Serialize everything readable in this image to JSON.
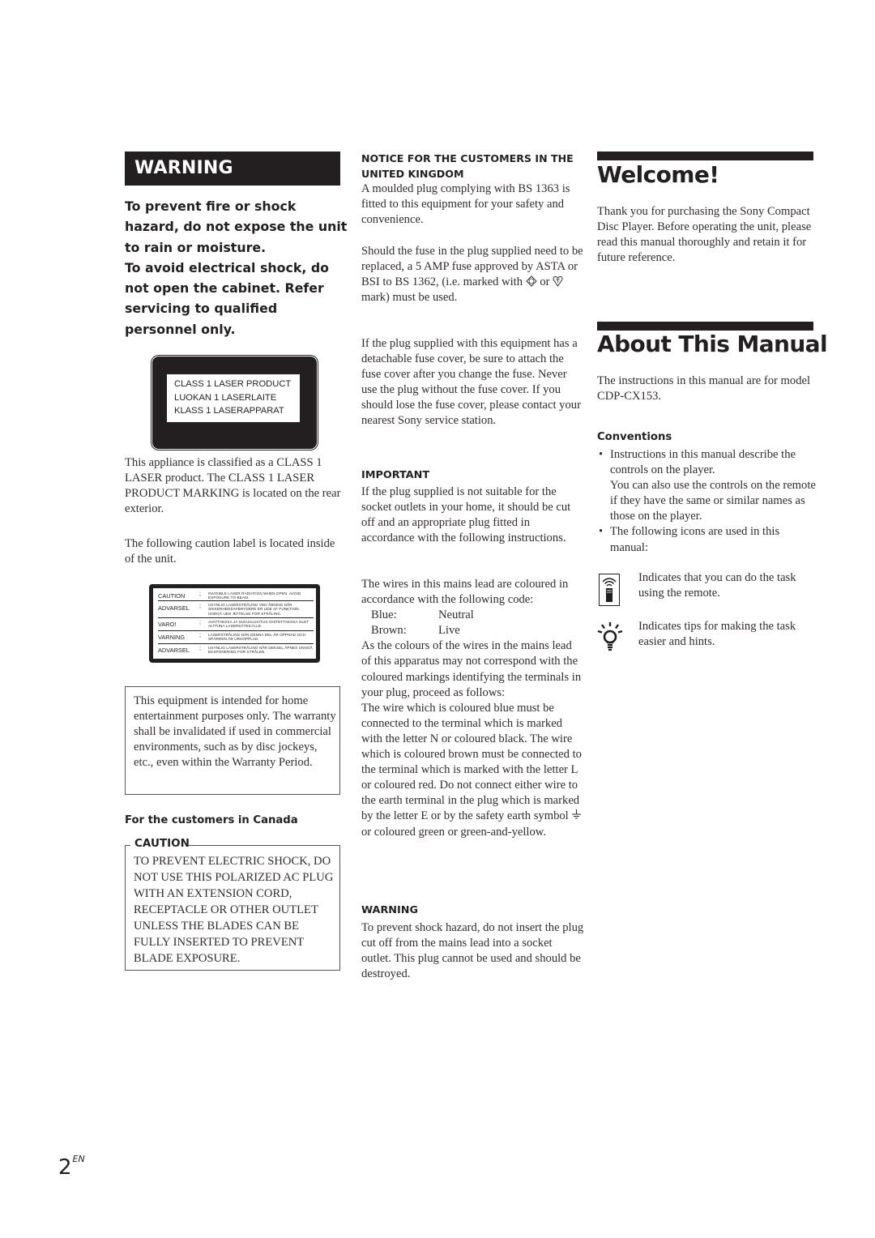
{
  "page": {
    "number": "2",
    "language_suffix": "EN"
  },
  "column1": {
    "warning_title": "WARNING",
    "warning_text": [
      "To prevent fire or shock",
      "hazard, do not expose the unit",
      "to rain or moisture.",
      "To avoid electrical shock, do",
      "not open the cabinet. Refer",
      "servicing to qualified",
      "personnel only."
    ],
    "laser_label": [
      "CLASS 1 LASER PRODUCT",
      "LUOKAN 1 LASERLAITE",
      "KLASS 1 LASERAPPARAT"
    ],
    "class_paragraph": "This appliance is classified as a CLASS 1 LASER product. The CLASS 1 LASER PRODUCT MARKING is located on the rear exterior.",
    "caution_label_intro": "The following caution label is located inside of the unit.",
    "caution_label": [
      {
        "lang": "CAUTION",
        "text": "INVISIBLE LASER RADIATION WHEN OPEN. AVOID EXPOSURE TO BEAM."
      },
      {
        "lang": "ADVARSEL",
        "text": "USYNLIG LASERSTRÅLING VED ÅBNING NÅR SIKKERHEDSAFBRYDERE ER UDE AF FUNKTION. UNDGÅ UDS ÆTTELSE FOR STRÅLING."
      },
      {
        "lang": "VARO!",
        "text": "AVATTAESSA JA SUOJALUKITUS OHITETTAESSA OLET ALTTIINA LASERSÄTEILYLLE."
      },
      {
        "lang": "VARNING",
        "text": "LASERSTRÅLING NÄR DENNA DEL ÄR OPPNAD OCH SPÄRREN ÄR URKOPPLAD."
      },
      {
        "lang": "ADVARSEL",
        "text": "USYNLIG LASERSTRÅLING NÅR DEKSEL ÅPNES UNNGÅ EKSPONERING FOR STRÅLEN."
      }
    ],
    "home_use_notice": "This equipment is intended for home entertainment purposes only. The warranty shall be invalidated if used in commercial environments, such as by disc jockeys, etc., even within the Warranty Period.",
    "canada_heading": "For the customers in Canada",
    "canada_caution_title": "CAUTION",
    "canada_caution_text": "TO PREVENT ELECTRIC SHOCK, DO NOT USE THIS POLARIZED AC PLUG WITH AN EXTENSION CORD, RECEPTACLE OR OTHER OUTLET UNLESS THE BLADES CAN BE FULLY INSERTED TO PREVENT BLADE EXPOSURE."
  },
  "column2": {
    "uk_heading": "NOTICE FOR THE CUSTOMERS IN THE UNITED KINGDOM",
    "uk_p1": "A moulded plug complying with BS 1363 is fitted to this equipment for your safety and convenience.",
    "uk_p2_before": "Should the fuse in the plug supplied need to be replaced, a 5 AMP fuse approved by ASTA or BSI to BS 1362, (i.e. marked with ",
    "uk_p2_mid": " or ",
    "uk_p2_after": " mark) must be used.",
    "uk_p3": "If the plug supplied with this equipment has a detachable fuse cover, be sure to attach the fuse cover after you change the fuse. Never use the plug without the fuse cover. If you should lose the fuse cover, please contact your nearest Sony service station.",
    "important_heading": "IMPORTANT",
    "important_text": "If the plug supplied is not suitable for the socket outlets in your home, it should be cut off and an appropriate plug fitted in accordance with the following instructions.",
    "wires_intro": "The wires in this mains lead are coloured in accordance with the following code:",
    "wire_codes": [
      {
        "colour": "Blue:",
        "meaning": "Neutral"
      },
      {
        "colour": "Brown:",
        "meaning": "Live"
      }
    ],
    "wires_p2": "As the colours of the wires in the mains lead of this apparatus may not correspond with the coloured markings identifying the terminals in your plug, proceed as follows:",
    "wires_p3_before": "The wire which is coloured blue must be connected to the terminal which is marked with the letter N or coloured black. The wire which is coloured brown must be connected to the terminal which is marked with the letter L or coloured red. Do not connect either wire to the earth terminal in the plug which is marked by the letter E or by the safety earth symbol ",
    "wires_p3_after": " or coloured green or green-and-yellow.",
    "warning_heading": "WARNING",
    "warning_text": "To prevent shock hazard, do not insert the plug cut off from the mains lead into a socket outlet. This plug cannot be used and should be destroyed."
  },
  "column3": {
    "welcome_title": "Welcome!",
    "welcome_text": "Thank you for purchasing the Sony Compact Disc Player. Before operating the unit, please read this manual thoroughly and retain it for future reference.",
    "about_title": "About This Manual",
    "about_text": "The instructions in this manual are for model CDP-CX153.",
    "conventions_heading": "Conventions",
    "conventions_bullets": [
      {
        "line1": "Instructions in this manual describe the controls on the player.",
        "line2": "You can also use the controls on the remote if they have the same or similar names as those on the player."
      },
      {
        "line1": "The following icons are used in this manual:",
        "line2": ""
      }
    ],
    "icons": [
      {
        "icon": "remote-control-icon",
        "text": "Indicates that you can do the task using the remote."
      },
      {
        "icon": "lightbulb-tip-icon",
        "text": "Indicates tips for making the task easier and hints."
      }
    ],
    "bullet_glyph": "•"
  }
}
